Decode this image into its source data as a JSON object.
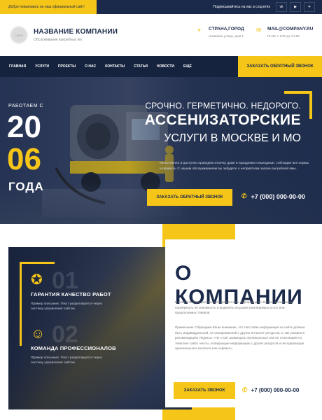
{
  "topbar": {
    "welcome": "Добро пожаловать на наш официальный сайт!",
    "subscribe": "Подписывайтесь на нас в соцсетях",
    "social": [
      {
        "icon": "vk-icon",
        "glyph": "vk"
      },
      {
        "icon": "youtube-icon",
        "glyph": "▶"
      },
      {
        "icon": "telegram-icon",
        "glyph": "✈"
      }
    ]
  },
  "header": {
    "company_name": "НАЗВАНИЕ КОМПАНИИ",
    "company_tagline": "Обслуживание выгребных ям",
    "location": {
      "title": "СТРАНА,ГОРОД",
      "subtitle": "Название улицы, дом 1",
      "icon": "location-icon"
    },
    "email": {
      "title": "MAIL@COMPANY.RU",
      "subtitle": "Пн-Вс с 9:00 до 21:00",
      "icon": "email-icon"
    }
  },
  "nav": {
    "items": [
      "ГЛАВНАЯ",
      "УСЛУГИ",
      "ПРОЕКТЫ",
      "О НАС",
      "КОНТАКТЫ",
      "СТАТЬИ",
      "НОВОСТИ",
      "ЕЩЁ"
    ],
    "cta": "ЗАКАЗАТЬ ОБРАТНЫЙ ЗВОНОК"
  },
  "hero": {
    "since": "РАБОТАЕМ С",
    "year_top": "20",
    "year_bottom": "06",
    "year_word": "ГОДА",
    "line1": "СРОЧНО. ГЕРМЕТИЧНО. НЕДОРОГО.",
    "line2": "АССЕНИЗАТОРСКИЕ",
    "line3": "УСЛУГИ В МОСКВЕ И МО",
    "description": "Качественно и доступно проведем откачку даже в праздники и выходные, соблюдая все нормы и правила. С нашим обслуживанием вы забудете о неприятном запахе выгребной ямы.",
    "button": "ЗАКАЗАТЬ ОБРАТНЫЙ ЗВОНОК",
    "phone": "+7 (000) 000-00-00"
  },
  "about": {
    "title": "О КОМПАНИИ",
    "paragraph1": "В этом блоке мы рекомендуем разместить информацию о Вашей организации, подчеркнуть ее значимость и выделить на рынке реализуемых услуг или предлагаемых товаров.",
    "paragraph2": "Примечание: Обращаем Ваше внимание, что текстовая информация на сайте должна быть индивидуальной, не скопированной с других интернет-ресурсов, и, как указано в рекомендациях Яндекса: «Не стоит размещать неуникальные или не относящиеся к тематике сайта тексты, копирующие информацию с других ресурсов и несодержащие оригинального контента или сервиса».",
    "button": "ЗАКАЗАТЬ ЗВОНОК",
    "phone": "+7 (000) 000-00-00",
    "features": [
      {
        "number": "01",
        "title": "ГАРАНТИЯ КАЧЕСТВО РАБОТ",
        "desc": "Пример описания. Текст редактируется через систему управления сайтом.",
        "icon": "quality-medal-icon"
      },
      {
        "number": "02",
        "title": "КОМАНДА ПРОФЕССИОНАЛОВ",
        "desc": "Пример описания. Текст редактируется через систему управления сайтом.",
        "icon": "team-icon"
      }
    ]
  },
  "colors": {
    "accent": "#f5c518",
    "navy": "#1b2a4a",
    "nav_bg": "#16233f"
  }
}
